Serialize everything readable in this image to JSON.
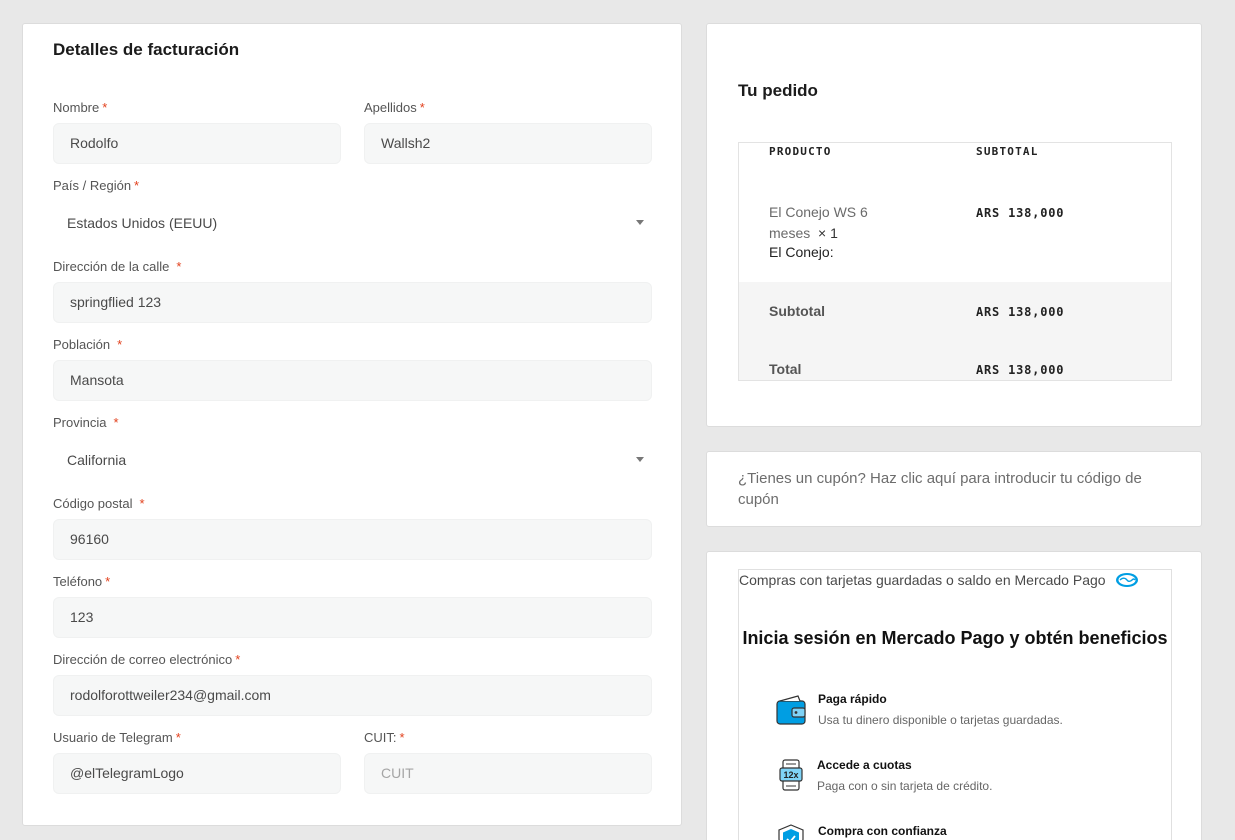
{
  "billing": {
    "title": "Detalles de facturación",
    "required_mark": "*",
    "nombre": {
      "label": "Nombre",
      "value": "Rodolfo"
    },
    "apellidos": {
      "label": "Apellidos",
      "value": "Wallsh2"
    },
    "pais": {
      "label": "País / Región",
      "value": "Estados Unidos (EEUU)"
    },
    "direccion": {
      "label": "Dirección de la calle",
      "value": "springflied 123"
    },
    "poblacion": {
      "label": "Población",
      "value": "Mansota"
    },
    "provincia": {
      "label": "Provincia",
      "value": "California"
    },
    "codigo_postal": {
      "label": "Código postal",
      "value": "96160"
    },
    "telefono": {
      "label": "Teléfono",
      "value": "123"
    },
    "email": {
      "label": "Dirección de correo electrónico",
      "value": "rodolforottweiler234@gmail.com"
    },
    "telegram": {
      "label": "Usuario de Telegram",
      "value": "@elTelegramLogo"
    },
    "cuit": {
      "label": "CUIT:",
      "placeholder": "CUIT"
    }
  },
  "order": {
    "title": "Tu pedido",
    "col_product": "PRODUCTO",
    "col_subtotal": "SUBTOTAL",
    "item": {
      "name": "El Conejo WS 6 meses",
      "qty": "× 1",
      "meta": "El Conejo:",
      "price": "ARS 138,000"
    },
    "subtotal": {
      "label": "Subtotal",
      "value": "ARS 138,000"
    },
    "total": {
      "label": "Total",
      "value": "ARS 138,000"
    }
  },
  "coupon": {
    "text": "¿Tienes un cupón? Haz clic aquí para introducir tu código de cupón"
  },
  "mercadopago": {
    "header": "Compras con tarjetas guardadas o saldo en Mercado Pago",
    "title": "Inicia sesión en Mercado Pago y obtén beneficios",
    "benefits": [
      {
        "title": "Paga rápido",
        "desc": "Usa tu dinero disponible o tarjetas guardadas.",
        "icon": "wallet-icon"
      },
      {
        "title": "Accede a cuotas",
        "desc": "Paga con o sin tarjeta de crédito.",
        "icon": "installments-icon",
        "badge": "12x"
      },
      {
        "title": "Compra con confianza",
        "desc": "",
        "icon": "shield-icon"
      }
    ],
    "colors": {
      "brand": "#009ee3",
      "brand_light": "#7fd3f7"
    }
  }
}
